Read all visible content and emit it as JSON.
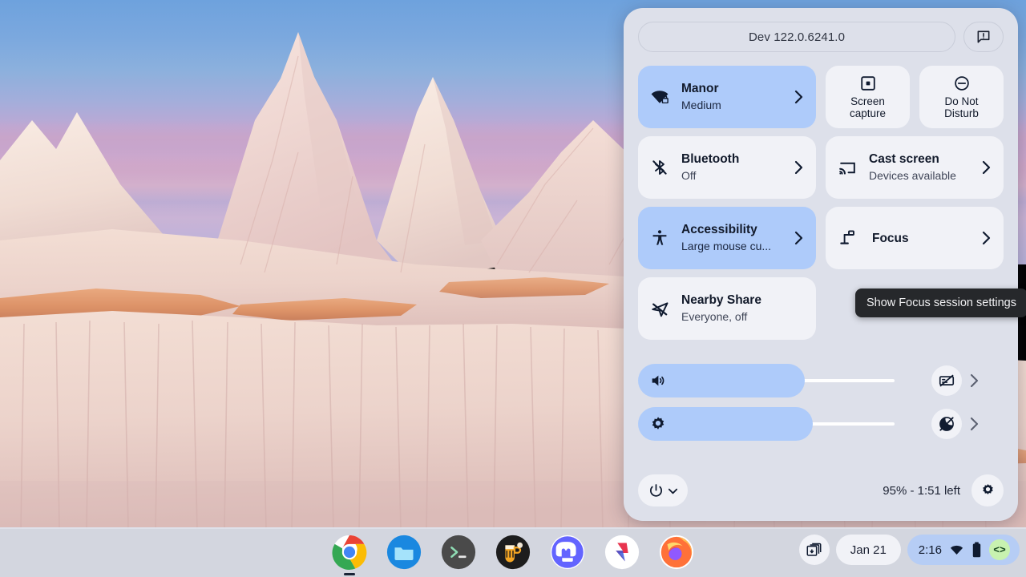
{
  "quick_settings": {
    "version": "Dev 122.0.6241.0",
    "feedback_icon": "feedback-icon",
    "tiles": [
      {
        "id": "network",
        "icon": "wifi-locked-icon",
        "title": "Manor",
        "subtitle": "Medium",
        "active": true,
        "chevron": "›"
      },
      {
        "id": "screen-capture",
        "icon": "screen-capture-icon",
        "label_line1": "Screen",
        "label_line2": "capture",
        "active": false
      },
      {
        "id": "do-not-disturb",
        "icon": "do-not-disturb-icon",
        "label_line1": "Do Not",
        "label_line2": "Disturb",
        "active": false
      },
      {
        "id": "bluetooth",
        "icon": "bluetooth-off-icon",
        "title": "Bluetooth",
        "subtitle": "Off",
        "active": false,
        "chevron": "›"
      },
      {
        "id": "cast",
        "icon": "cast-icon",
        "title": "Cast screen",
        "subtitle": "Devices available",
        "active": false,
        "chevron": "›"
      },
      {
        "id": "accessibility",
        "icon": "accessibility-icon",
        "title": "Accessibility",
        "subtitle": "Large mouse cu...",
        "active": true,
        "chevron": "›"
      },
      {
        "id": "focus",
        "icon": "desk-lamp-icon",
        "title": "Focus",
        "subtitle": "",
        "active": false,
        "chevron": "›"
      },
      {
        "id": "nearby-share",
        "icon": "nearby-share-off-icon",
        "title": "Nearby Share",
        "subtitle": "Everyone, off",
        "active": false
      }
    ],
    "tooltip": "Show Focus session settings",
    "sliders": [
      {
        "id": "volume",
        "icon": "volume-icon",
        "value": 65,
        "trailing_icon": "mic-muted-icon",
        "chevron": "›"
      },
      {
        "id": "brightness",
        "icon": "brightness-icon",
        "value": 68,
        "trailing_icon": "night-light-off-icon",
        "chevron": "›"
      }
    ],
    "power_label": "power-button",
    "battery_status": "95% - 1:51 left",
    "settings_icon": "gear-icon"
  },
  "shelf": {
    "apps": [
      {
        "name": "chrome",
        "label": "Chrome",
        "running": true
      },
      {
        "name": "files",
        "label": "Files",
        "running": false
      },
      {
        "name": "terminal",
        "label": "Terminal",
        "running": false
      },
      {
        "name": "beer-app",
        "label": "Untappd",
        "running": false
      },
      {
        "name": "mastodon",
        "label": "Mastodon",
        "running": false
      },
      {
        "name": "s-app",
        "label": "Sketch",
        "running": false
      },
      {
        "name": "firefox",
        "label": "Firefox",
        "running": false
      }
    ],
    "files_icon": "files-tray-icon",
    "date": "Jan 21",
    "time": "2:16",
    "wifi_icon": "wifi-icon",
    "battery_icon": "battery-icon",
    "dev_badge": "<>"
  },
  "colors": {
    "panel_bg": "#dde0ea",
    "tile_bg": "#f1f2f7",
    "tile_active": "#aecbfa",
    "tooltip_bg": "#26282b",
    "tray_active": "#b6cdf5",
    "dev_badge_bg": "#c8f2b0"
  }
}
